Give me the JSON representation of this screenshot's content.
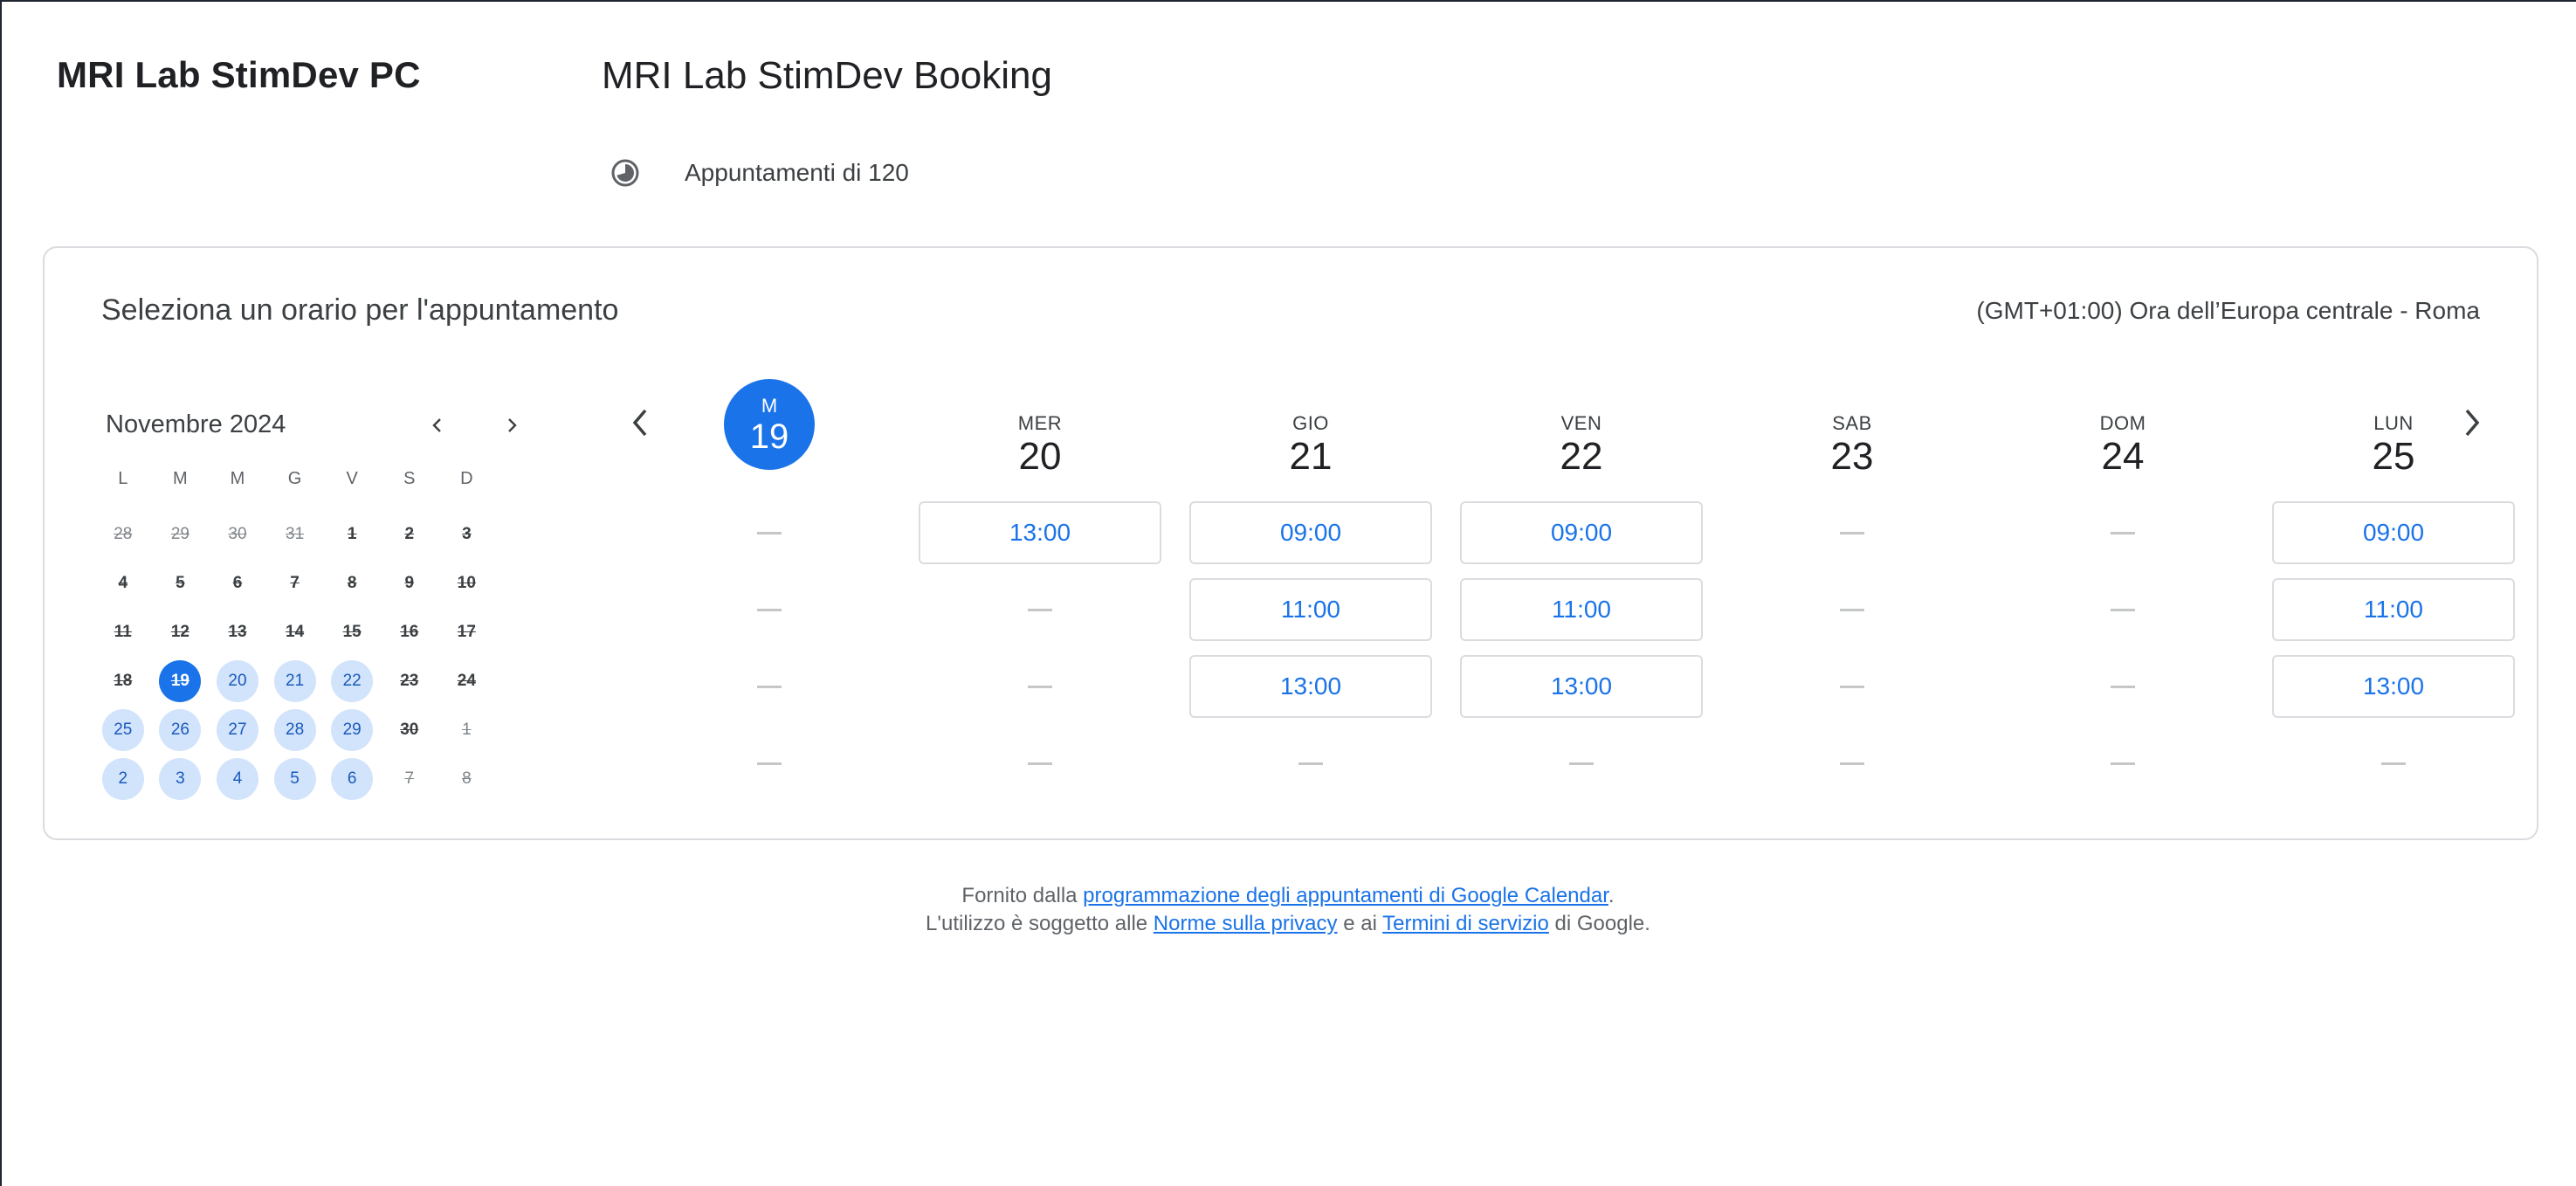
{
  "app": {
    "title": "MRI Lab StimDev PC"
  },
  "booking": {
    "title": "MRI Lab StimDev Booking",
    "duration": "Appuntamenti di 120"
  },
  "card": {
    "title": "Seleziona un orario per l'appuntamento",
    "timezone": "(GMT+01:00) Ora dell’Europa centrale - Roma"
  },
  "mini_calendar": {
    "month": "Novembre 2024",
    "weekdays": [
      "L",
      "M",
      "M",
      "G",
      "V",
      "S",
      "D"
    ],
    "days": [
      {
        "n": "28",
        "s": "other"
      },
      {
        "n": "29",
        "s": "other"
      },
      {
        "n": "30",
        "s": "other"
      },
      {
        "n": "31",
        "s": "other"
      },
      {
        "n": "1",
        "s": "past"
      },
      {
        "n": "2",
        "s": "past"
      },
      {
        "n": "3",
        "s": "past"
      },
      {
        "n": "4",
        "s": "past"
      },
      {
        "n": "5",
        "s": "past"
      },
      {
        "n": "6",
        "s": "past"
      },
      {
        "n": "7",
        "s": "past"
      },
      {
        "n": "8",
        "s": "past"
      },
      {
        "n": "9",
        "s": "past"
      },
      {
        "n": "10",
        "s": "past"
      },
      {
        "n": "11",
        "s": "past"
      },
      {
        "n": "12",
        "s": "past"
      },
      {
        "n": "13",
        "s": "past"
      },
      {
        "n": "14",
        "s": "past"
      },
      {
        "n": "15",
        "s": "past"
      },
      {
        "n": "16",
        "s": "past"
      },
      {
        "n": "17",
        "s": "past"
      },
      {
        "n": "18",
        "s": "past"
      },
      {
        "n": "19",
        "s": "selected"
      },
      {
        "n": "20",
        "s": "avail"
      },
      {
        "n": "21",
        "s": "avail"
      },
      {
        "n": "22",
        "s": "avail"
      },
      {
        "n": "23",
        "s": "past"
      },
      {
        "n": "24",
        "s": "past"
      },
      {
        "n": "25",
        "s": "avail"
      },
      {
        "n": "26",
        "s": "avail"
      },
      {
        "n": "27",
        "s": "avail"
      },
      {
        "n": "28",
        "s": "avail"
      },
      {
        "n": "29",
        "s": "avail"
      },
      {
        "n": "30",
        "s": "past"
      },
      {
        "n": "1",
        "s": "other"
      },
      {
        "n": "2",
        "s": "avail"
      },
      {
        "n": "3",
        "s": "avail"
      },
      {
        "n": "4",
        "s": "avail"
      },
      {
        "n": "5",
        "s": "avail"
      },
      {
        "n": "6",
        "s": "avail"
      },
      {
        "n": "7",
        "s": "other"
      },
      {
        "n": "8",
        "s": "other"
      }
    ]
  },
  "week": {
    "days": [
      {
        "dow": "M",
        "date": "19",
        "today": true,
        "slots": [
          null,
          null,
          null,
          null
        ]
      },
      {
        "dow": "MER",
        "date": "20",
        "slots": [
          "13:00",
          null,
          null,
          null
        ]
      },
      {
        "dow": "GIO",
        "date": "21",
        "slots": [
          "09:00",
          "11:00",
          "13:00",
          null
        ]
      },
      {
        "dow": "VEN",
        "date": "22",
        "slots": [
          "09:00",
          "11:00",
          "13:00",
          null
        ]
      },
      {
        "dow": "SAB",
        "date": "23",
        "slots": [
          null,
          null,
          null,
          null
        ]
      },
      {
        "dow": "DOM",
        "date": "24",
        "slots": [
          null,
          null,
          null,
          null
        ]
      },
      {
        "dow": "LUN",
        "date": "25",
        "slots": [
          "09:00",
          "11:00",
          "13:00",
          null
        ]
      }
    ]
  },
  "footer": {
    "line1_prefix": "Fornito dalla ",
    "line1_link": "programmazione degli appuntamenti di Google Calendar",
    "line1_suffix": ".",
    "line2_prefix": "L'utilizzo è soggetto alle ",
    "privacy_link": "Norme sulla privacy",
    "line2_mid": " e ai ",
    "terms_link": "Termini di servizio",
    "line2_suffix": " di Google."
  },
  "colors": {
    "accent": "#1a73e8",
    "available_bg": "#d2e3fc",
    "border": "#dadce0"
  },
  "icons": {
    "duration": "duration-clock-icon",
    "prev": "chevron-left-icon",
    "next": "chevron-right-icon"
  }
}
